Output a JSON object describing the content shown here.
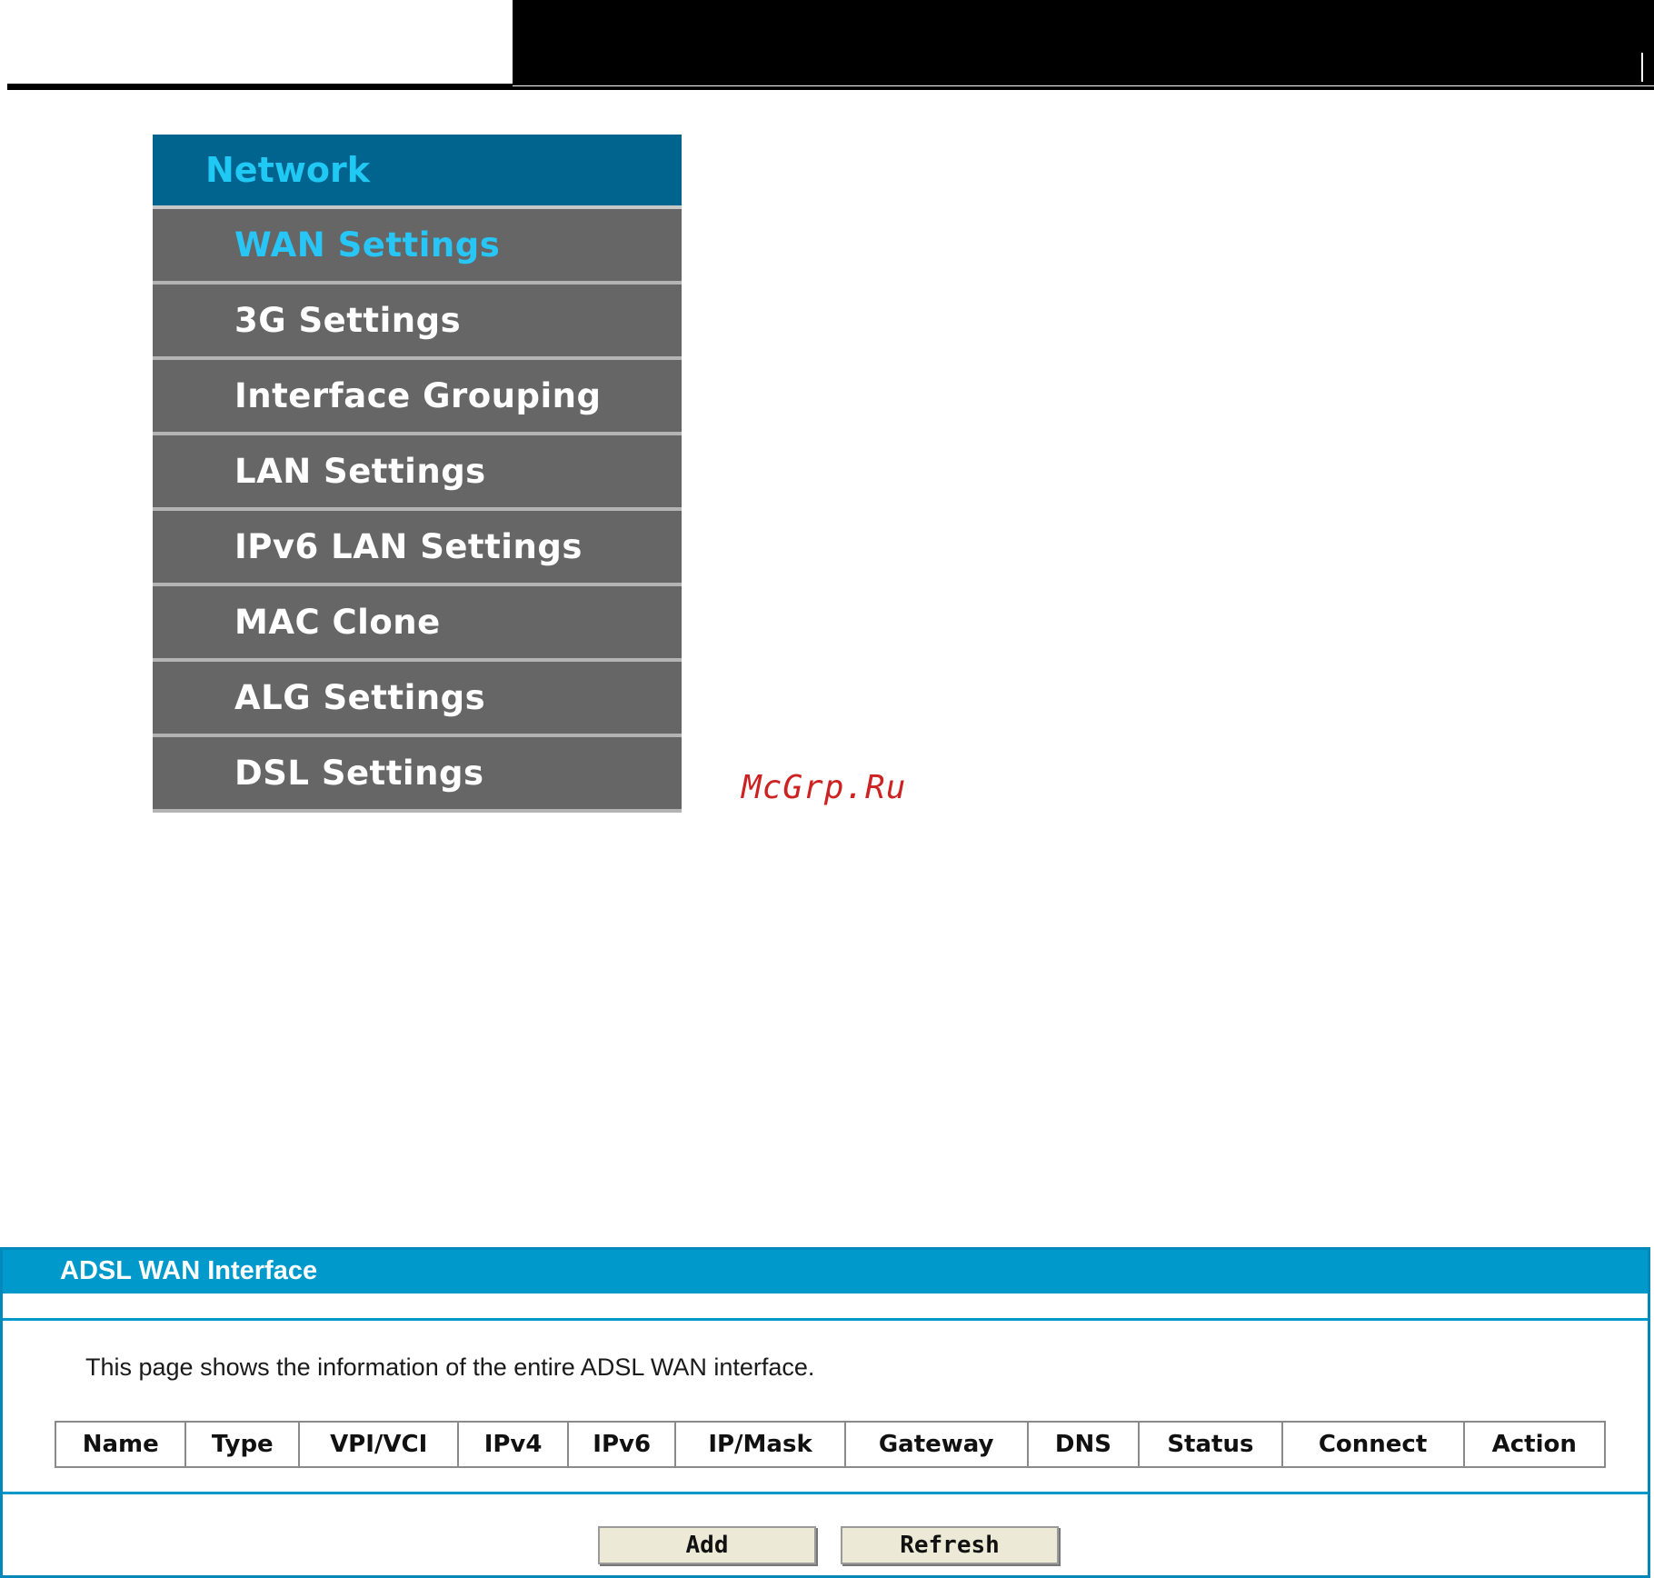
{
  "menu": {
    "title": "Network",
    "items": [
      {
        "label": "WAN Settings",
        "active": true
      },
      {
        "label": "3G Settings",
        "active": false
      },
      {
        "label": "Interface Grouping",
        "active": false
      },
      {
        "label": "LAN Settings",
        "active": false
      },
      {
        "label": "IPv6 LAN Settings",
        "active": false
      },
      {
        "label": "MAC Clone",
        "active": false
      },
      {
        "label": "ALG Settings",
        "active": false
      },
      {
        "label": "DSL Settings",
        "active": false
      }
    ]
  },
  "watermark": "McGrp.Ru",
  "panel": {
    "title": "ADSL WAN Interface",
    "description": "This page shows the information of the entire ADSL WAN interface.",
    "columns": [
      "Name",
      "Type",
      "VPI/VCI",
      "IPv4",
      "IPv6",
      "IP/Mask",
      "Gateway",
      "DNS",
      "Status",
      "Connect",
      "Action"
    ],
    "buttons": {
      "add": "Add",
      "refresh": "Refresh"
    }
  },
  "colors": {
    "menu_header_bg": "#00648e",
    "menu_active_text": "#27c6f6",
    "menu_item_bg": "#666666",
    "panel_accent": "#0099cc",
    "watermark": "#cc2222"
  }
}
